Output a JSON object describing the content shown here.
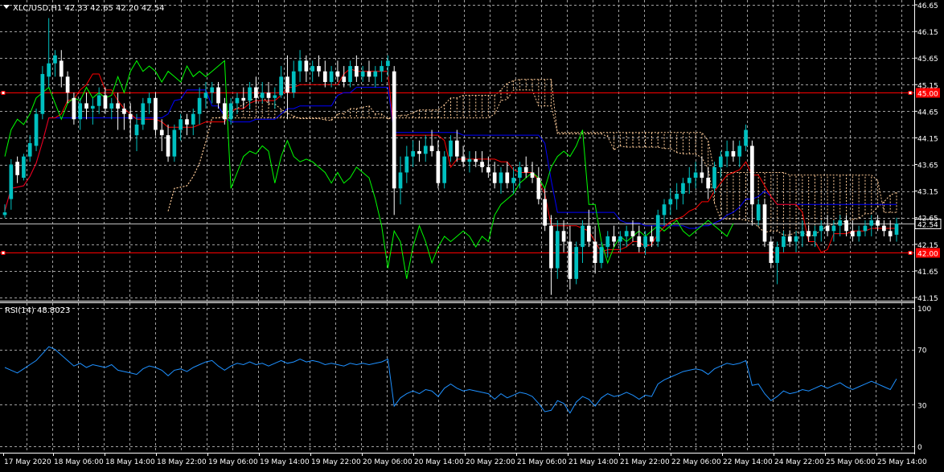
{
  "main_chart": {
    "info_label": "XLC/USD,H1  42.33 42.65 42.20 42.54",
    "price_labels": [
      "46.65",
      "46.15",
      "45.65",
      "45.15",
      "44.65",
      "44.15",
      "43.65",
      "43.15",
      "42.65",
      "42.15",
      "41.65",
      "41.15"
    ],
    "hlines": [
      {
        "label": "45.00",
        "color": "#ff0000"
      },
      {
        "label": "42.00",
        "color": "#ff0000"
      }
    ],
    "current_price": "42.54"
  },
  "rsi_panel": {
    "info_label": "RSI(14) 48.8023",
    "level_labels": [
      "100",
      "70",
      "30",
      "0"
    ]
  },
  "time_labels": [
    "17 May 2020",
    "18 May 06:00",
    "18 May 14:00",
    "18 May 22:00",
    "19 May 06:00",
    "19 May 14:00",
    "19 May 22:00",
    "20 May 06:00",
    "20 May 14:00",
    "20 May 22:00",
    "21 May 06:00",
    "21 May 14:00",
    "21 May 22:00",
    "22 May 06:00",
    "22 May 14:00",
    "24 May 22:00",
    "25 May 06:00",
    "25 May 14:00"
  ],
  "colors": {
    "background": "#000000",
    "grid": "#a0a0a0",
    "bull_candle": "#00c0c0",
    "bear_candle": "#ffffff",
    "tenkan": "#ff0000",
    "kijun": "#0000ff",
    "chikou": "#00ff00",
    "cloud": "#ffcc99",
    "rsi_line": "#1e90ff"
  },
  "chart_data": {
    "type": "candlestick",
    "symbol": "XLC/USD",
    "timeframe": "H1",
    "ohlc_last": {
      "open": 42.33,
      "high": 42.65,
      "low": 42.2,
      "close": 42.54
    },
    "ylim": [
      41.15,
      46.65
    ],
    "candles": [
      [
        42.7,
        42.9,
        42.65,
        42.75
      ],
      [
        43.0,
        43.75,
        42.8,
        43.65
      ],
      [
        43.7,
        43.8,
        43.3,
        43.45
      ],
      [
        43.4,
        43.85,
        43.35,
        43.8
      ],
      [
        43.8,
        44.2,
        43.7,
        44.05
      ],
      [
        44.0,
        44.7,
        43.9,
        44.6
      ],
      [
        44.6,
        45.5,
        44.5,
        45.35
      ],
      [
        45.3,
        46.4,
        45.1,
        45.55
      ],
      [
        45.55,
        45.8,
        45.3,
        45.7
      ],
      [
        45.6,
        45.8,
        45.1,
        45.3
      ],
      [
        45.3,
        45.4,
        44.8,
        45.0
      ],
      [
        44.9,
        45.0,
        44.4,
        44.5
      ],
      [
        44.5,
        44.9,
        44.3,
        44.8
      ],
      [
        44.8,
        45.0,
        44.5,
        44.7
      ],
      [
        44.7,
        44.9,
        44.4,
        44.75
      ],
      [
        44.75,
        45.1,
        44.6,
        44.95
      ],
      [
        44.95,
        45.1,
        44.6,
        44.7
      ],
      [
        44.7,
        44.9,
        44.5,
        44.8
      ],
      [
        44.8,
        45.0,
        44.3,
        44.7
      ],
      [
        44.7,
        44.8,
        44.3,
        44.6
      ],
      [
        44.6,
        44.8,
        44.1,
        44.5
      ],
      [
        44.2,
        44.6,
        43.9,
        44.4
      ],
      [
        44.4,
        44.9,
        44.3,
        44.8
      ],
      [
        44.8,
        45.0,
        44.6,
        44.9
      ],
      [
        44.9,
        45.0,
        44.2,
        44.3
      ],
      [
        44.3,
        44.5,
        43.9,
        44.2
      ],
      [
        44.2,
        44.4,
        43.7,
        43.8
      ],
      [
        43.8,
        44.4,
        43.7,
        44.3
      ],
      [
        44.3,
        44.6,
        44.1,
        44.5
      ],
      [
        44.5,
        44.6,
        44.2,
        44.4
      ],
      [
        44.4,
        44.7,
        44.2,
        44.6
      ],
      [
        44.6,
        45.1,
        44.4,
        44.9
      ],
      [
        44.9,
        45.2,
        44.7,
        45.0
      ],
      [
        45.0,
        45.2,
        44.8,
        45.1
      ],
      [
        45.1,
        45.2,
        44.7,
        44.8
      ],
      [
        44.8,
        44.9,
        44.4,
        44.5
      ],
      [
        44.5,
        44.9,
        44.4,
        44.8
      ],
      [
        44.8,
        45.0,
        44.6,
        44.9
      ],
      [
        44.9,
        45.1,
        44.7,
        44.85
      ],
      [
        44.85,
        45.2,
        44.7,
        45.1
      ],
      [
        45.1,
        45.3,
        44.8,
        44.9
      ],
      [
        44.9,
        45.2,
        44.8,
        45.0
      ],
      [
        45.0,
        45.2,
        44.8,
        44.9
      ],
      [
        44.9,
        45.1,
        44.7,
        44.95
      ],
      [
        44.95,
        45.5,
        44.9,
        45.3
      ],
      [
        45.3,
        45.7,
        44.5,
        45.0
      ],
      [
        45.0,
        45.6,
        44.9,
        45.4
      ],
      [
        45.4,
        45.8,
        45.2,
        45.6
      ],
      [
        45.6,
        45.7,
        45.2,
        45.4
      ],
      [
        45.4,
        45.6,
        45.2,
        45.5
      ],
      [
        45.5,
        45.7,
        45.3,
        45.4
      ],
      [
        45.4,
        45.6,
        45.1,
        45.2
      ],
      [
        45.2,
        45.5,
        45.1,
        45.4
      ],
      [
        45.4,
        45.6,
        45.2,
        45.3
      ],
      [
        45.3,
        45.5,
        45.1,
        45.2
      ],
      [
        45.2,
        45.6,
        45.1,
        45.5
      ],
      [
        45.5,
        45.7,
        45.2,
        45.3
      ],
      [
        45.3,
        45.5,
        45.2,
        45.4
      ],
      [
        45.4,
        45.6,
        45.2,
        45.3
      ],
      [
        45.3,
        45.5,
        45.1,
        45.4
      ],
      [
        45.4,
        45.6,
        45.2,
        45.5
      ],
      [
        45.5,
        45.7,
        45.3,
        45.6
      ],
      [
        45.4,
        45.5,
        42.7,
        43.2
      ],
      [
        43.2,
        43.8,
        42.9,
        43.5
      ],
      [
        43.5,
        44.0,
        43.3,
        43.8
      ],
      [
        43.8,
        44.1,
        43.6,
        43.9
      ],
      [
        43.9,
        44.1,
        43.7,
        43.85
      ],
      [
        43.85,
        44.2,
        43.7,
        44.0
      ],
      [
        44.0,
        44.3,
        43.8,
        43.9
      ],
      [
        43.9,
        44.1,
        43.2,
        43.3
      ],
      [
        43.3,
        43.9,
        43.2,
        43.8
      ],
      [
        43.8,
        44.2,
        43.7,
        44.1
      ],
      [
        44.1,
        44.3,
        43.7,
        43.8
      ],
      [
        43.8,
        44.0,
        43.6,
        43.7
      ],
      [
        43.7,
        43.9,
        43.5,
        43.75
      ],
      [
        43.75,
        43.9,
        43.6,
        43.7
      ],
      [
        43.7,
        43.9,
        43.5,
        43.6
      ],
      [
        43.6,
        43.8,
        43.4,
        43.5
      ],
      [
        43.5,
        43.7,
        43.2,
        43.3
      ],
      [
        43.3,
        43.6,
        43.1,
        43.5
      ],
      [
        43.5,
        43.7,
        43.2,
        43.3
      ],
      [
        43.3,
        43.6,
        43.1,
        43.4
      ],
      [
        43.4,
        43.7,
        43.2,
        43.6
      ],
      [
        43.6,
        43.8,
        43.4,
        43.5
      ],
      [
        43.5,
        43.7,
        43.3,
        43.4
      ],
      [
        43.4,
        43.6,
        42.9,
        43.0
      ],
      [
        43.0,
        43.2,
        42.4,
        42.5
      ],
      [
        42.5,
        42.7,
        41.2,
        41.7
      ],
      [
        41.7,
        42.6,
        41.5,
        42.4
      ],
      [
        42.4,
        42.6,
        42.0,
        42.2
      ],
      [
        42.2,
        42.5,
        41.3,
        41.5
      ],
      [
        41.5,
        42.2,
        41.4,
        42.1
      ],
      [
        42.1,
        42.6,
        41.8,
        42.5
      ],
      [
        42.5,
        42.8,
        42.1,
        42.2
      ],
      [
        42.2,
        42.5,
        41.6,
        41.8
      ],
      [
        41.8,
        42.2,
        41.7,
        42.1
      ],
      [
        42.1,
        42.4,
        41.9,
        42.3
      ],
      [
        42.3,
        42.5,
        42.1,
        42.2
      ],
      [
        42.2,
        42.4,
        42.0,
        42.3
      ],
      [
        42.3,
        42.5,
        42.1,
        42.4
      ],
      [
        42.4,
        42.6,
        42.2,
        42.3
      ],
      [
        42.3,
        42.5,
        42.0,
        42.1
      ],
      [
        42.1,
        42.4,
        41.95,
        42.3
      ],
      [
        42.3,
        42.5,
        42.1,
        42.2
      ],
      [
        42.2,
        42.8,
        42.1,
        42.7
      ],
      [
        42.7,
        43.0,
        42.5,
        42.9
      ],
      [
        42.9,
        43.2,
        42.7,
        43.0
      ],
      [
        43.0,
        43.3,
        42.8,
        43.1
      ],
      [
        43.1,
        43.4,
        42.9,
        43.3
      ],
      [
        43.3,
        43.6,
        43.1,
        43.4
      ],
      [
        43.4,
        43.7,
        43.2,
        43.5
      ],
      [
        43.5,
        43.8,
        43.3,
        43.4
      ],
      [
        43.4,
        43.6,
        43.0,
        43.2
      ],
      [
        43.2,
        43.7,
        43.1,
        43.6
      ],
      [
        43.6,
        43.9,
        43.4,
        43.8
      ],
      [
        43.8,
        44.1,
        43.6,
        43.9
      ],
      [
        43.9,
        44.1,
        43.7,
        43.8
      ],
      [
        43.8,
        44.1,
        43.6,
        44.0
      ],
      [
        44.0,
        44.4,
        43.9,
        44.3
      ],
      [
        44.0,
        44.1,
        42.5,
        42.9
      ],
      [
        42.6,
        43.0,
        42.5,
        42.9
      ],
      [
        42.9,
        43.0,
        42.1,
        42.2
      ],
      [
        42.2,
        42.3,
        41.7,
        41.8
      ],
      [
        41.8,
        42.2,
        41.4,
        42.1
      ],
      [
        42.1,
        42.4,
        42.0,
        42.3
      ],
      [
        42.3,
        42.4,
        42.1,
        42.2
      ],
      [
        42.2,
        42.4,
        42.0,
        42.3
      ],
      [
        42.3,
        42.6,
        42.1,
        42.4
      ],
      [
        42.4,
        42.5,
        42.2,
        42.3
      ],
      [
        42.3,
        42.5,
        42.1,
        42.4
      ],
      [
        42.4,
        42.6,
        42.2,
        42.5
      ],
      [
        42.5,
        42.7,
        42.3,
        42.4
      ],
      [
        42.4,
        42.6,
        42.2,
        42.5
      ],
      [
        42.5,
        42.7,
        42.3,
        42.6
      ],
      [
        42.6,
        42.7,
        42.3,
        42.4
      ],
      [
        42.4,
        42.6,
        42.2,
        42.3
      ],
      [
        42.3,
        42.5,
        42.2,
        42.4
      ],
      [
        42.4,
        42.6,
        42.3,
        42.5
      ],
      [
        42.5,
        42.7,
        42.3,
        42.6
      ],
      [
        42.6,
        42.7,
        42.4,
        42.5
      ],
      [
        42.5,
        42.6,
        42.3,
        42.4
      ],
      [
        42.4,
        42.6,
        42.2,
        42.3
      ],
      [
        42.33,
        42.65,
        42.2,
        42.54
      ]
    ],
    "hlines": [
      45.0,
      42.0
    ],
    "rsi": {
      "period": 14,
      "last": 48.8023,
      "ylim": [
        0,
        100
      ],
      "levels": [
        30,
        70
      ],
      "values": [
        57,
        55,
        53,
        56,
        59,
        62,
        67,
        72,
        70,
        66,
        62,
        58,
        60,
        57,
        59,
        58,
        57,
        59,
        55,
        54,
        53,
        52,
        56,
        58,
        57,
        55,
        51,
        55,
        56,
        54,
        57,
        59,
        61,
        62,
        58,
        55,
        58,
        60,
        59,
        61,
        59,
        60,
        58,
        60,
        62,
        60,
        61,
        63,
        61,
        62,
        61,
        59,
        60,
        59,
        58,
        60,
        59,
        60,
        59,
        60,
        61,
        63,
        29,
        35,
        38,
        40,
        38,
        41,
        40,
        36,
        42,
        45,
        42,
        40,
        41,
        40,
        39,
        38,
        34,
        38,
        35,
        37,
        39,
        38,
        36,
        31,
        25,
        26,
        33,
        31,
        24,
        32,
        36,
        34,
        29,
        35,
        38,
        36,
        37,
        39,
        37,
        34,
        37,
        36,
        45,
        48,
        50,
        52,
        54,
        55,
        56,
        55,
        52,
        56,
        58,
        60,
        59,
        60,
        62,
        44,
        45,
        38,
        33,
        36,
        40,
        38,
        39,
        41,
        40,
        42,
        44,
        42,
        44,
        46,
        43,
        41,
        43,
        45,
        47,
        45,
        43,
        41,
        48.8
      ]
    }
  }
}
